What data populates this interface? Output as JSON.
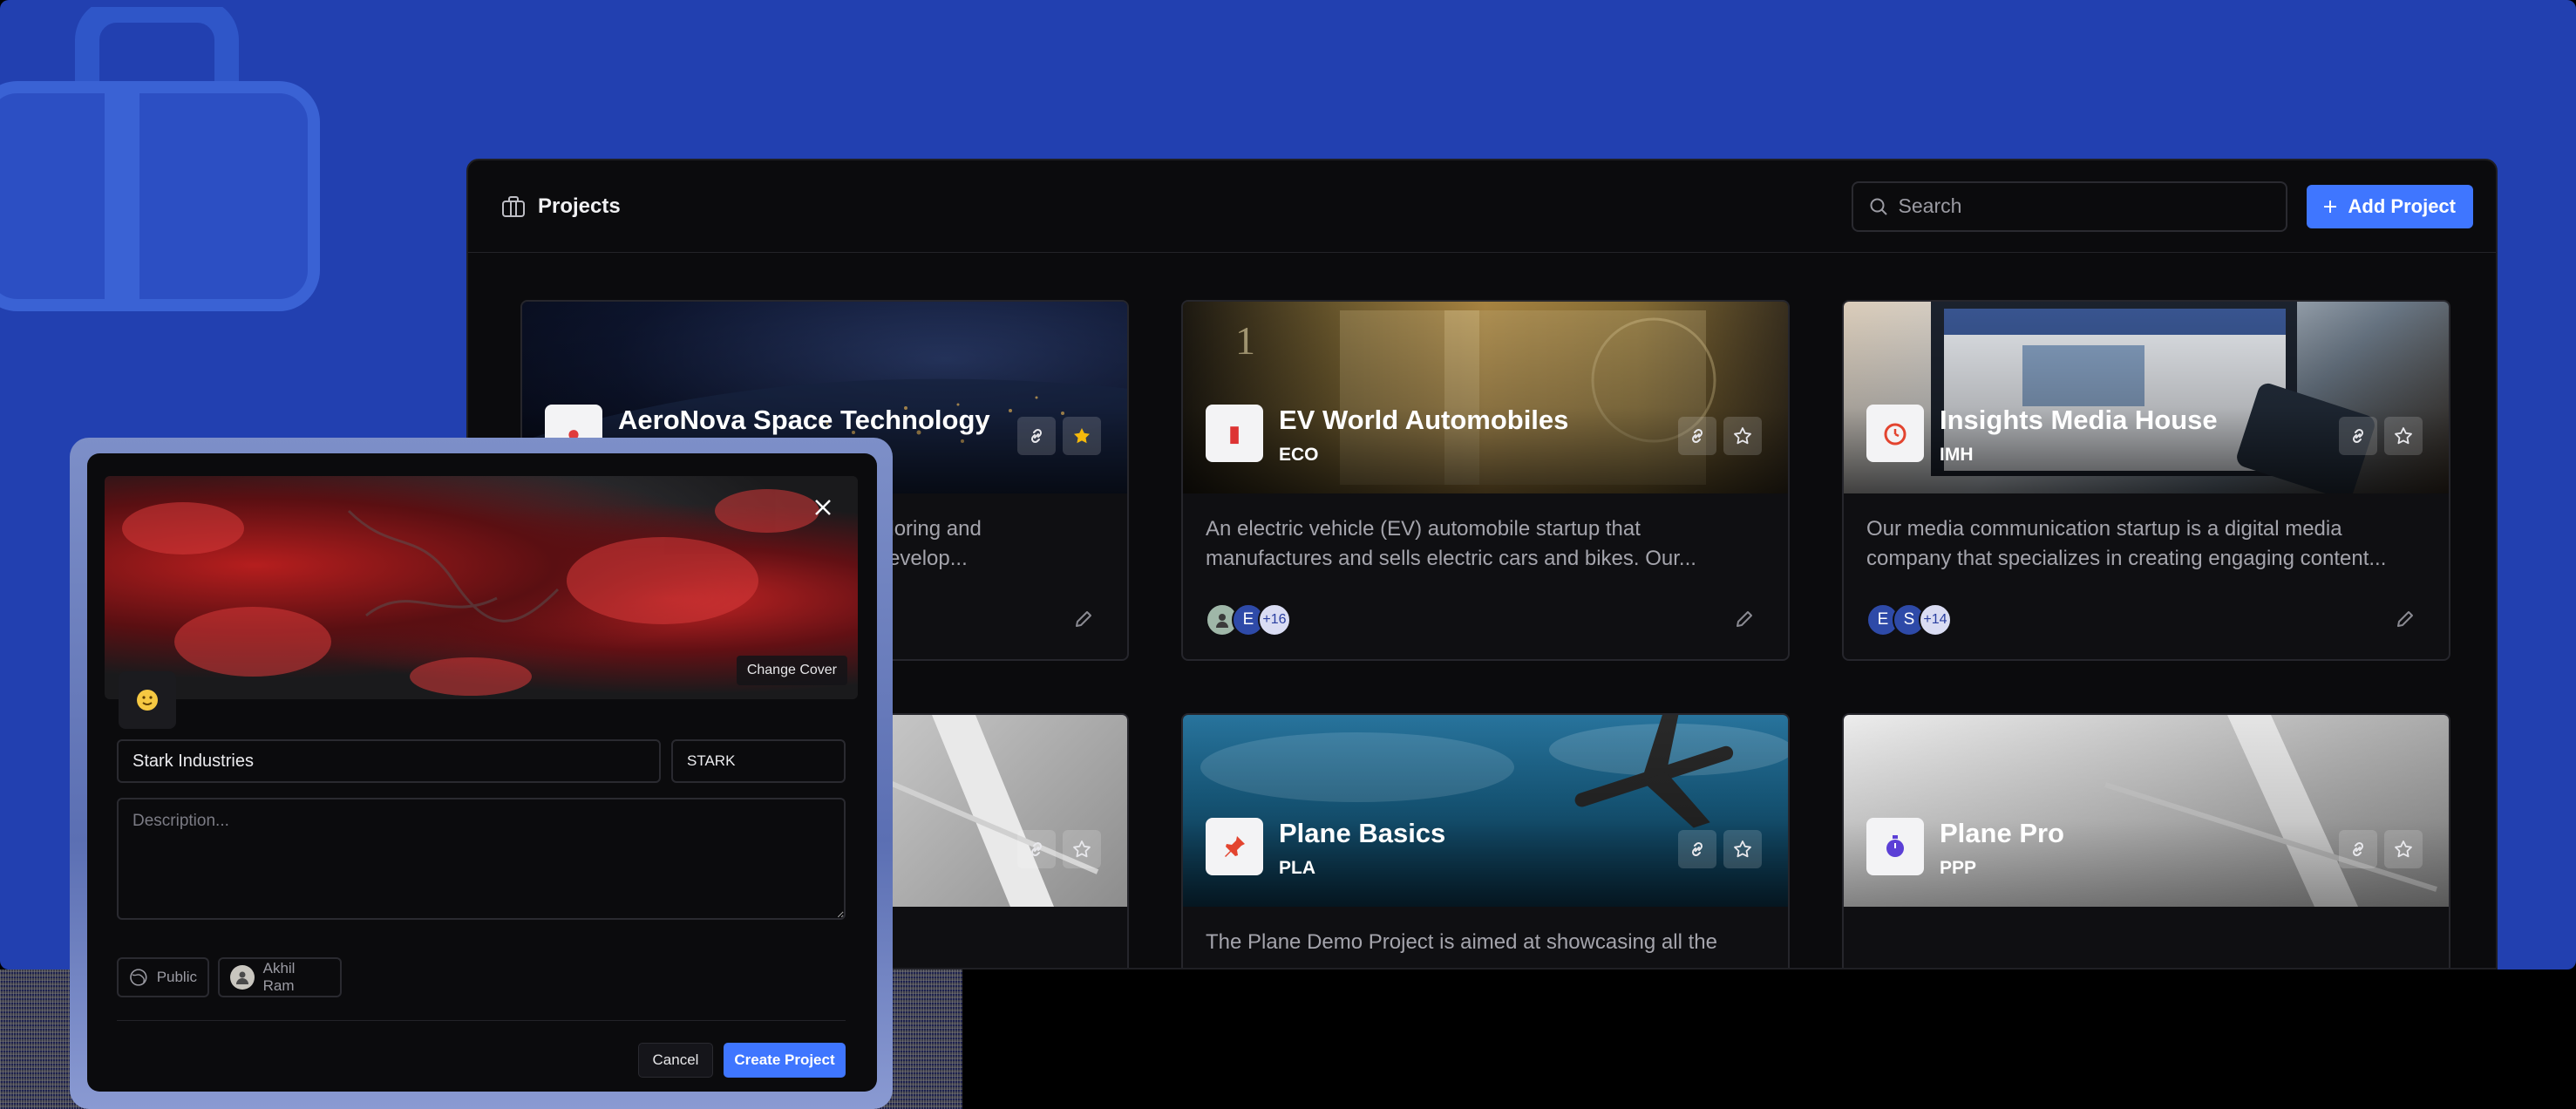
{
  "header": {
    "title": "Projects",
    "search_placeholder": "Search",
    "add_label": "Add Project"
  },
  "projects": [
    {
      "name": "AeroNova Space Technology",
      "key": "",
      "description": "to exploring and\nis to develop...",
      "starred": true
    },
    {
      "name": "EV World Automobiles",
      "key": "ECO",
      "description": "An electric vehicle (EV) automobile startup that manufactures and sells electric cars and bikes. Our...",
      "members": [
        "E"
      ],
      "more": "+16"
    },
    {
      "name": "Insights Media House",
      "key": "IMH",
      "description": "Our media communication startup is a digital media company that specializes in creating engaging content...",
      "members": [
        "E",
        "S"
      ],
      "more": "+14"
    },
    {
      "name": "",
      "key": "",
      "description": ""
    },
    {
      "name": "Plane Basics",
      "key": "PLA",
      "description": "The Plane Demo Project is aimed at showcasing all the"
    },
    {
      "name": "Plane Pro",
      "key": "PPP",
      "description": ""
    }
  ],
  "modal": {
    "change_cover": "Change Cover",
    "name_value": "Stark Industries",
    "identifier_value": "STARK",
    "description_placeholder": "Description...",
    "network": "Public",
    "lead": "Akhil Ram",
    "cancel": "Cancel",
    "create": "Create Project"
  },
  "colors": {
    "background_blue": "#2240b0",
    "accent": "#3f76ff",
    "surface": "#0b0b0d"
  }
}
